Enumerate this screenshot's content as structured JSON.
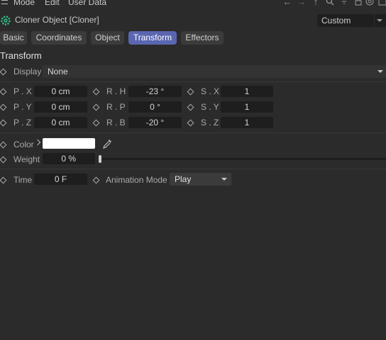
{
  "menu": {
    "items": [
      "Mode",
      "Edit",
      "User Data"
    ]
  },
  "toolbar": {
    "icons": [
      "arrow-left-icon",
      "arrow-right-icon",
      "arrow-up-icon",
      "search-icon",
      "filter-icon",
      "lock-icon",
      "target-icon",
      "add-icon"
    ]
  },
  "header": {
    "title": "Cloner Object [Cloner]",
    "preset": "Custom"
  },
  "tabs": [
    {
      "label": "Basic",
      "active": false
    },
    {
      "label": "Coordinates",
      "active": false
    },
    {
      "label": "Object",
      "active": false
    },
    {
      "label": "Transform",
      "active": true
    },
    {
      "label": "Effectors",
      "active": false
    }
  ],
  "section": {
    "title": "Transform"
  },
  "display": {
    "label": "Display",
    "value": "None"
  },
  "position": {
    "x_label": "P . X",
    "x_value": "0 cm",
    "y_label": "P . Y",
    "y_value": "0 cm",
    "z_label": "P . Z",
    "z_value": "0 cm"
  },
  "rotation": {
    "h_label": "R . H",
    "h_value": "-23 °",
    "p_label": "R . P",
    "p_value": "0 °",
    "b_label": "R . B",
    "b_value": "-20 °"
  },
  "scale": {
    "x_label": "S . X",
    "x_value": "1",
    "y_label": "S . Y",
    "y_value": "1",
    "z_label": "S . Z",
    "z_value": "1"
  },
  "color": {
    "label": "Color",
    "value": "#ffffff"
  },
  "weight": {
    "label": "Weight",
    "value": "0 %",
    "fraction": 0
  },
  "time": {
    "label": "Time",
    "value": "0 F"
  },
  "animation_mode": {
    "label": "Animation Mode",
    "value": "Play"
  },
  "colors": {
    "accent": "#5a66b0",
    "background": "#2b2b2b",
    "field": "#1e1e1e"
  }
}
